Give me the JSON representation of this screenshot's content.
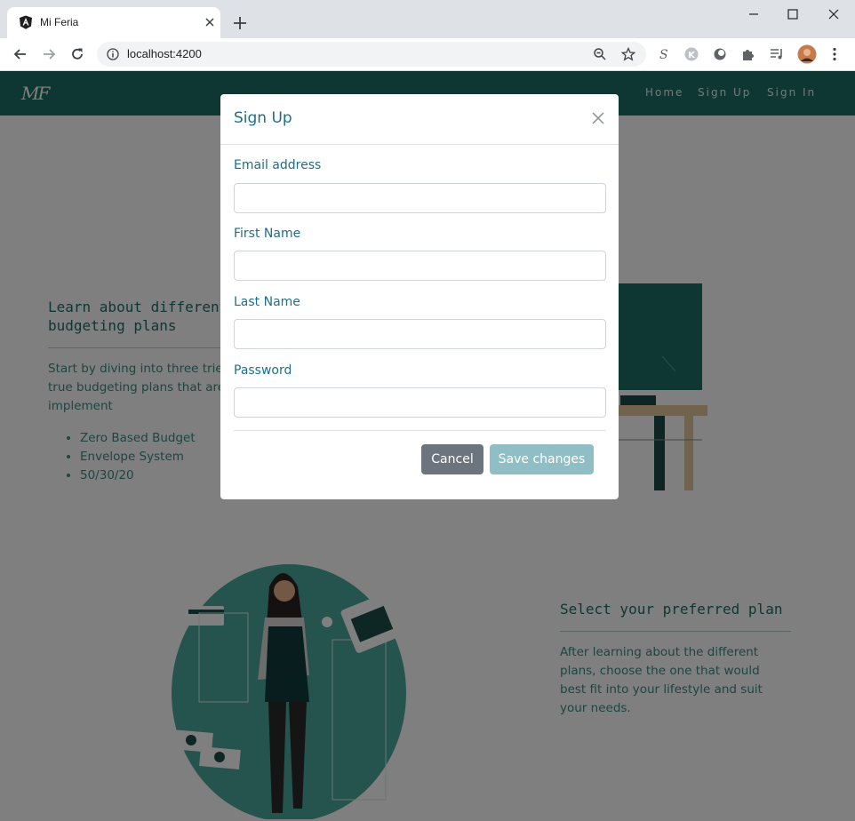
{
  "browser": {
    "tab_title": "Mi Feria",
    "url": "localhost:4200"
  },
  "site": {
    "brand": "MF",
    "nav": [
      "Home",
      "Sign Up",
      "Sign In"
    ]
  },
  "section1": {
    "title_line1": "Learn about different",
    "title_line2": "budgeting plans",
    "text_line1": "Start by diving into three tried",
    "text_line2": "true budgeting plans that are easy to",
    "text_line3": "implement",
    "items": [
      "Zero Based Budget",
      "Envelope System",
      "50/30/20"
    ]
  },
  "section2": {
    "title": "Select your preferred plan",
    "text_line1": "After learning about the different",
    "text_line2": "plans, choose the one that would",
    "text_line3": "best fit into your lifestyle and suit",
    "text_line4": "your needs."
  },
  "modal": {
    "title": "Sign Up",
    "fields": [
      {
        "label": "Email address",
        "value": ""
      },
      {
        "label": "First Name",
        "value": ""
      },
      {
        "label": "Last Name",
        "value": ""
      },
      {
        "label": "Password",
        "value": ""
      }
    ],
    "cancel_label": "Cancel",
    "save_label": "Save changes"
  },
  "colors": {
    "navbar": "#1d6e66",
    "accent": "#1d6e8a",
    "cancel": "#6c757d",
    "save_disabled": "#8fbfc4"
  }
}
